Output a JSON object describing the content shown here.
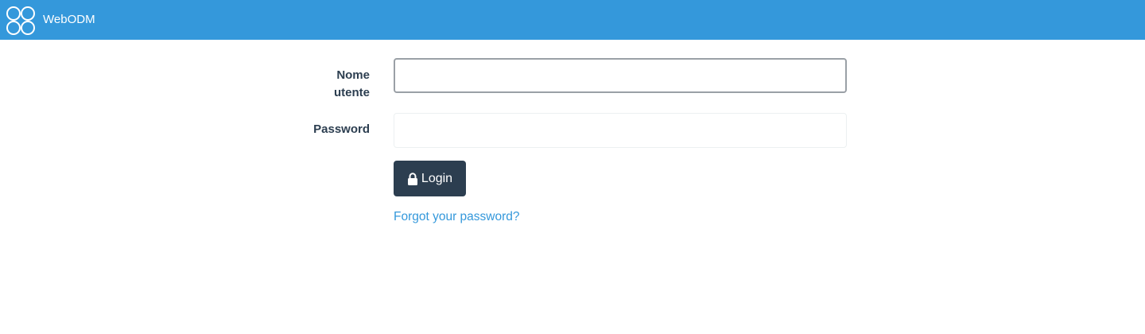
{
  "navbar": {
    "brand": "WebODM",
    "logo_icon": "webodm-logo-icon",
    "background": "#3498db"
  },
  "form": {
    "username_label": "Nome utente",
    "username_value": "",
    "password_label": "Password",
    "password_value": "",
    "login_label": "Login",
    "login_icon": "lock-icon",
    "forgot_link": "Forgot your password?"
  },
  "colors": {
    "primary": "#3498db",
    "dark": "#2c3e50",
    "link": "#3498db"
  }
}
